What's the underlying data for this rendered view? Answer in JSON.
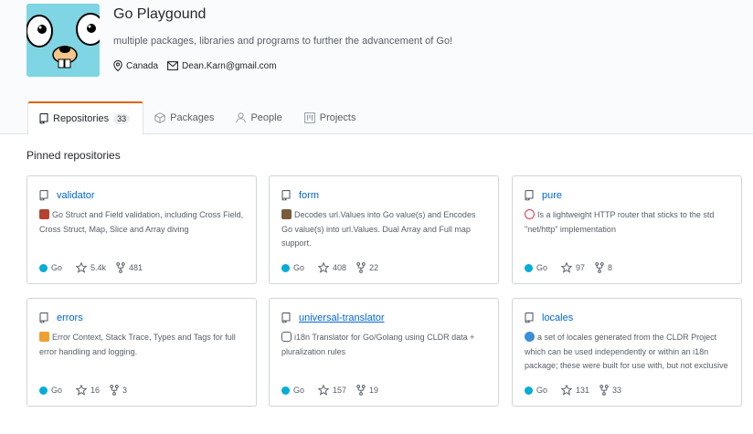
{
  "org": {
    "name": "Go Playgound",
    "description": "multiple packages, libraries and programs to further the advancement of Go!",
    "location": "Canada",
    "email": "Dean.Karn@gmail.com"
  },
  "tabs": [
    {
      "label": "Repositories",
      "count": "33",
      "icon": "repo-icon",
      "active": true
    },
    {
      "label": "Packages",
      "icon": "package-icon"
    },
    {
      "label": "People",
      "icon": "person-icon"
    },
    {
      "label": "Projects",
      "icon": "project-icon"
    }
  ],
  "pinned_title": "Pinned repositories",
  "repos": [
    {
      "name": "validator",
      "emoji": "sparkling-heart-like",
      "description": "Go Struct and Field validation, including Cross Field, Cross Struct, Map, Slice and Array diving",
      "language": "Go",
      "stars": "5.4k",
      "forks": "481"
    },
    {
      "name": "form",
      "emoji": "clipboard-like",
      "description": "Decodes url.Values into Go value(s) and Encodes Go value(s) into url.Values. Dual Array and Full map support.",
      "language": "Go",
      "stars": "408",
      "forks": "22"
    },
    {
      "name": "pure",
      "emoji": "no-entry-like",
      "description": "Is a lightweight HTTP router that sticks to the std \"net/http\" implementation",
      "language": "Go",
      "stars": "97",
      "forks": "8"
    },
    {
      "name": "errors",
      "emoji": "boom-like",
      "description": "Error Context, Stack Trace, Types and Tags for full error handling and logging.",
      "language": "Go",
      "stars": "16",
      "forks": "3"
    },
    {
      "name": "universal-translator",
      "emoji": "speech-balloon-icon",
      "description": "i18n Translator for Go/Golang using CLDR data + pluralization rules",
      "language": "Go",
      "stars": "157",
      "forks": "19"
    },
    {
      "name": "locales",
      "emoji": "globe-icon",
      "description": "a set of locales generated from the CLDR Project which can be used independently or within an i18n package; these were built for use with, but not exclusive to https://github.com/go-playground/un...",
      "language": "Go",
      "stars": "131",
      "forks": "33"
    }
  ],
  "colors": {
    "go": "#00add8",
    "link": "#0366d6",
    "tab_accent": "#e36209"
  }
}
